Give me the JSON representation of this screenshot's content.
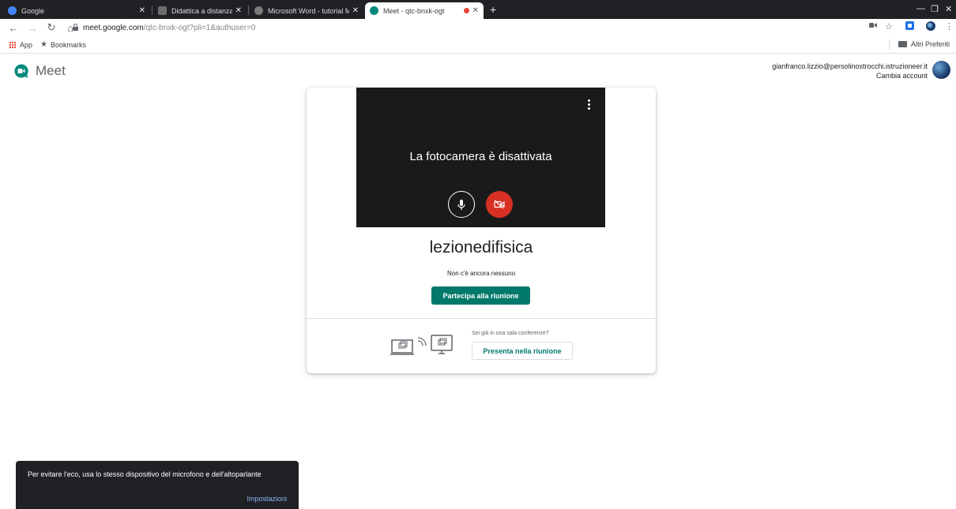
{
  "browser": {
    "tabs": [
      {
        "label": "Google",
        "favicon_color": "#4285f4"
      },
      {
        "label": "Didattica a distanza | I.P. \"PER",
        "favicon_color": "#6d6d6d"
      },
      {
        "label": "Microsoft Word - tutorial Meet",
        "favicon_color": "#7b7b7b"
      },
      {
        "label": "Meet - qtc-bnxk-ogt",
        "favicon_color": "#00897b"
      }
    ],
    "url_host": "meet.google.com",
    "url_path": "/qtc-bnxk-ogt?pli=1&authuser=0",
    "bookmarks": {
      "apps_label": "App",
      "bookmarks_label": "Bookmarks",
      "other_label": "Altri Preferiti"
    }
  },
  "header": {
    "app_name": "Meet",
    "account_email": "gianfranco.lizzio@persolinostrocchi.istruzioneer.it",
    "switch_account": "Cambia account"
  },
  "preview": {
    "camera_off_message": "La fotocamera è disattivata",
    "meeting_name": "lezionedifisica",
    "status": "Non c'è ancora nessuno",
    "join_label": "Partecipa alla riunione",
    "present_question": "Sei già in una sala conferenze?",
    "present_label": "Presenta nella riunione"
  },
  "snackbar": {
    "message": "Per evitare l'eco, usa lo stesso dispositivo del microfono e dell'altoparlante",
    "action": "Impostazioni"
  },
  "colors": {
    "accent": "#00796b",
    "camera_off": "#d93025",
    "snackbar_action": "#8ab4f8"
  }
}
